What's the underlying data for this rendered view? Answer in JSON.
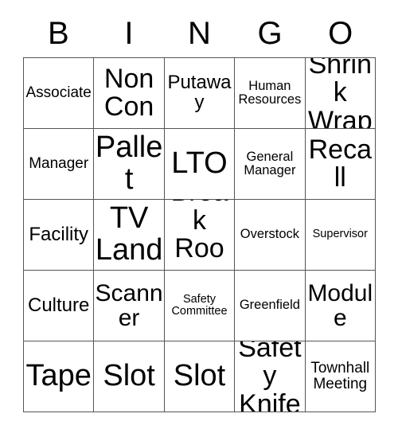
{
  "card": {
    "title": "BINGO",
    "header_letters": [
      "B",
      "I",
      "N",
      "G",
      "O"
    ],
    "columns": 5,
    "rows": 5,
    "border_color": "#555555",
    "background_color": "#ffffff",
    "text_color": "#000000"
  },
  "grid": {
    "cells": [
      {
        "text": "Associate",
        "size": "fs-s"
      },
      {
        "text": "Non Con",
        "size": "fs-xl"
      },
      {
        "text": "Putaway",
        "size": "fs-m"
      },
      {
        "text": "Human Resources",
        "size": "fs-xs"
      },
      {
        "text": "Shrink Wrap",
        "size": "fs-xl"
      },
      {
        "text": "Manager",
        "size": "fs-s"
      },
      {
        "text": "Pallet",
        "size": "fs-xxl"
      },
      {
        "text": "LTO",
        "size": "fs-xxl"
      },
      {
        "text": "General Manager",
        "size": "fs-xs"
      },
      {
        "text": "Recall",
        "size": "fs-xl"
      },
      {
        "text": "Facility",
        "size": "fs-m"
      },
      {
        "text": "TV Land",
        "size": "fs-xxl"
      },
      {
        "text": "Break Room",
        "size": "fs-xl"
      },
      {
        "text": "Overstock",
        "size": "fs-xs"
      },
      {
        "text": "Supervisor",
        "size": "fs-xxs"
      },
      {
        "text": "Culture",
        "size": "fs-m"
      },
      {
        "text": "Scanner",
        "size": "fs-l"
      },
      {
        "text": "Safety Committee",
        "size": "fs-xxs"
      },
      {
        "text": "Greenfield",
        "size": "fs-xs"
      },
      {
        "text": "Module",
        "size": "fs-l"
      },
      {
        "text": "Tape",
        "size": "fs-xxl"
      },
      {
        "text": "Slot",
        "size": "fs-xxl"
      },
      {
        "text": "Slot",
        "size": "fs-xxl"
      },
      {
        "text": "Safety Knife",
        "size": "fs-xl"
      },
      {
        "text": "Townhall Meeting",
        "size": "fs-s"
      }
    ]
  }
}
